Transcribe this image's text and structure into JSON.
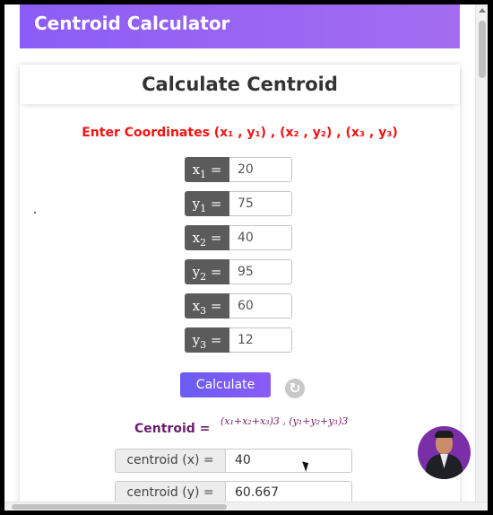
{
  "header": {
    "title": "Centroid Calculator"
  },
  "card": {
    "title": "Calculate Centroid",
    "instruction": "Enter Coordinates (x₁ , y₁) , (x₂ , y₂) , (x₃ , y₃)"
  },
  "inputs": [
    {
      "var": "x",
      "sub": "1",
      "value": "20"
    },
    {
      "var": "y",
      "sub": "1",
      "value": "75"
    },
    {
      "var": "x",
      "sub": "2",
      "value": "40"
    },
    {
      "var": "y",
      "sub": "2",
      "value": "95"
    },
    {
      "var": "x",
      "sub": "3",
      "value": "60"
    },
    {
      "var": "y",
      "sub": "3",
      "value": "12"
    }
  ],
  "equals": "=",
  "buttons": {
    "calculate": "Calculate",
    "reset_icon": "refresh-icon"
  },
  "result": {
    "label": "Centroid",
    "equals": "=",
    "formula": "(x₁+x₂+x₃)3 , (y₁+y₂+y₃)3",
    "outputs": [
      {
        "label": "centroid (x) =",
        "value": "40"
      },
      {
        "label": "centroid (y) =",
        "value": "60.667"
      }
    ]
  },
  "colors": {
    "banner": "#8c5cf6",
    "instruction": "#f21313",
    "label_bg": "#5b5b5b",
    "centroid_text": "#6a1d6c",
    "button": "#6a5cf2"
  }
}
